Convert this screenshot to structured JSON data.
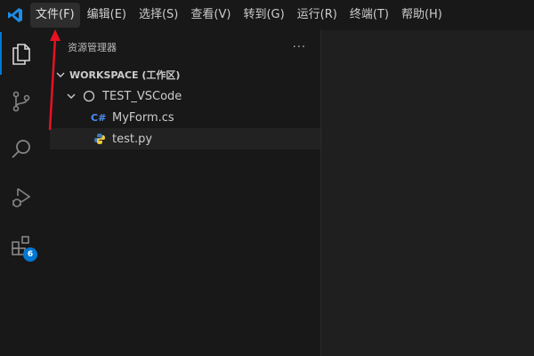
{
  "menu": {
    "items": [
      "文件(F)",
      "编辑(E)",
      "选择(S)",
      "查看(V)",
      "转到(G)",
      "运行(R)",
      "终端(T)",
      "帮助(H)"
    ]
  },
  "activity": {
    "extensions_badge": "6"
  },
  "explorer": {
    "title": "资源管理器",
    "more": "···",
    "workspace_label": "WORKSPACE (工作区)",
    "folder_name": "TEST_VSCode",
    "files": [
      {
        "name": "MyForm.cs",
        "icon": "C#"
      },
      {
        "name": "test.py",
        "icon": "python-icon"
      }
    ]
  },
  "colors": {
    "accent": "#0078d4",
    "annotation_arrow": "#e81123"
  }
}
